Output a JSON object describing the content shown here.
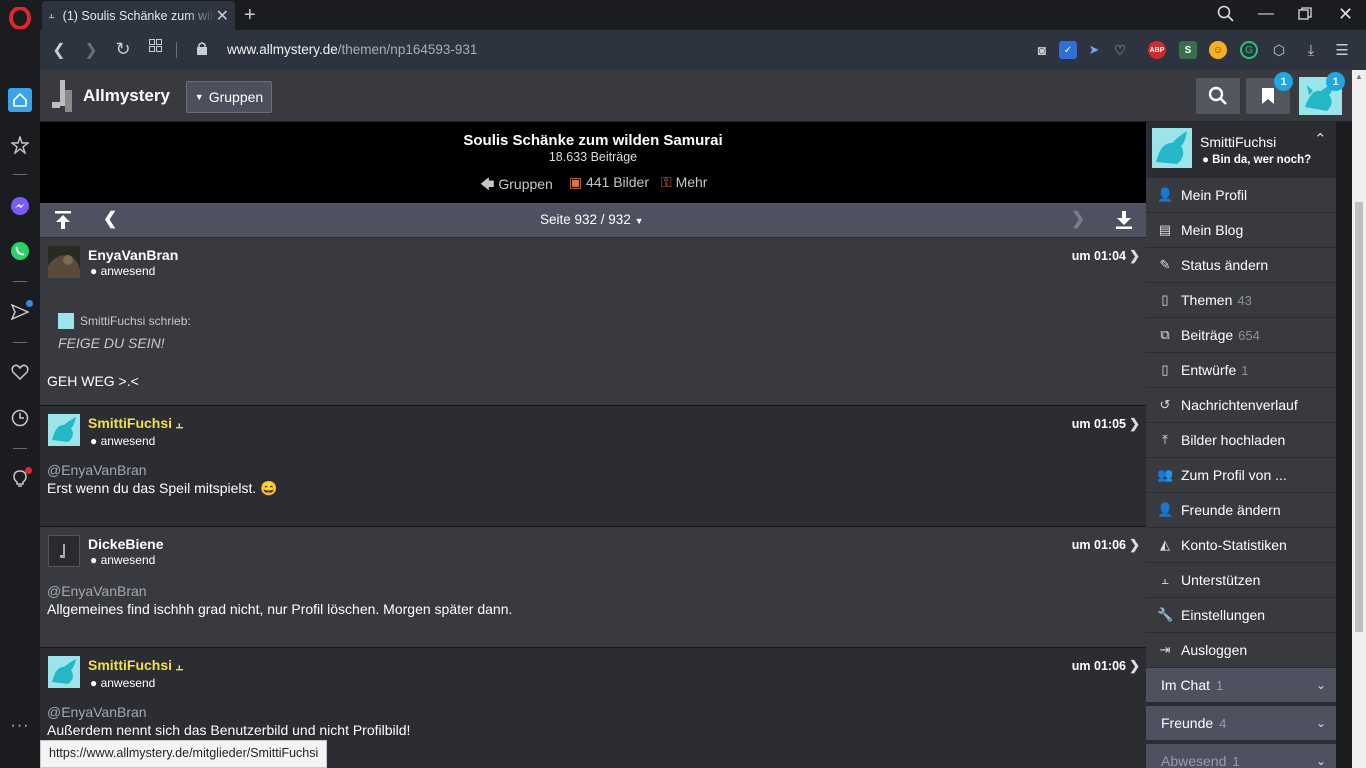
{
  "browser": {
    "tab_title": "(1) Soulis Schänke zum wilden",
    "url_host": "www.allmystery.de",
    "url_path": "/themen/np164593-931",
    "adblock_label": "ABP"
  },
  "site": {
    "logo": "Allmystery",
    "groups_button": "Gruppen",
    "bookmark_badge": "1",
    "avatar_badge": "1"
  },
  "thread": {
    "title": "Soulis Schänke zum wilden Samurai",
    "posts_count": "18.633 Beiträge",
    "link_groups": "Gruppen",
    "link_images": "441 Bilder",
    "link_more": "Mehr",
    "page_label": "Seite 932 / 932"
  },
  "posts": [
    {
      "user": "EnyaVanBran",
      "status": "● anwesend",
      "time": "um 01:04",
      "quote_author": "SmittiFuchsi schrieb:",
      "quote_text": "FEIGE DU SEIN!",
      "text": "GEH WEG >.<"
    },
    {
      "user": "SmittiFuchsi",
      "status": "● anwesend",
      "time": "um 01:05",
      "mention": "@EnyaVanBran",
      "text": "Erst wenn du das Speil mitspielst. 😄"
    },
    {
      "user": "DickeBiene",
      "status": "● anwesend",
      "time": "um 01:06",
      "mention": "@EnyaVanBran",
      "text": "Allgemeines find ischhh grad nicht, nur Profil löschen. Morgen später dann."
    },
    {
      "user": "SmittiFuchsi",
      "status": "● anwesend",
      "time": "um 01:06",
      "mention": "@EnyaVanBran",
      "text": "Außerdem nennt sich das Benutzerbild und nicht Profilbild!"
    }
  ],
  "panel": {
    "username": "SmittiFuchsi",
    "status": "● Bin da, wer noch?",
    "menu": [
      {
        "label": "Mein Profil",
        "count": ""
      },
      {
        "label": "Mein Blog",
        "count": ""
      },
      {
        "label": "Status ändern",
        "count": ""
      },
      {
        "label": "Themen",
        "count": "43"
      },
      {
        "label": "Beiträge",
        "count": "654"
      },
      {
        "label": "Entwürfe",
        "count": "1"
      },
      {
        "label": "Nachrichtenverlauf",
        "count": ""
      },
      {
        "label": "Bilder hochladen",
        "count": ""
      },
      {
        "label": "Zum Profil von ...",
        "count": ""
      },
      {
        "label": "Freunde ändern",
        "count": ""
      },
      {
        "label": "Konto-Statistiken",
        "count": ""
      },
      {
        "label": "Unterstützen",
        "count": ""
      },
      {
        "label": "Einstellungen",
        "count": ""
      },
      {
        "label": "Ausloggen",
        "count": ""
      }
    ],
    "sections": [
      {
        "label": "Im Chat",
        "count": "1"
      },
      {
        "label": "Freunde",
        "count": "4"
      },
      {
        "label": "Abwesend",
        "count": "1"
      }
    ]
  },
  "status_url": "https://www.allmystery.de/mitglieder/SmittiFuchsi",
  "icons": {
    "browser": "opera-logo-icon",
    "accent": "#1ea7e0",
    "user_highlight": "#f0e050"
  }
}
